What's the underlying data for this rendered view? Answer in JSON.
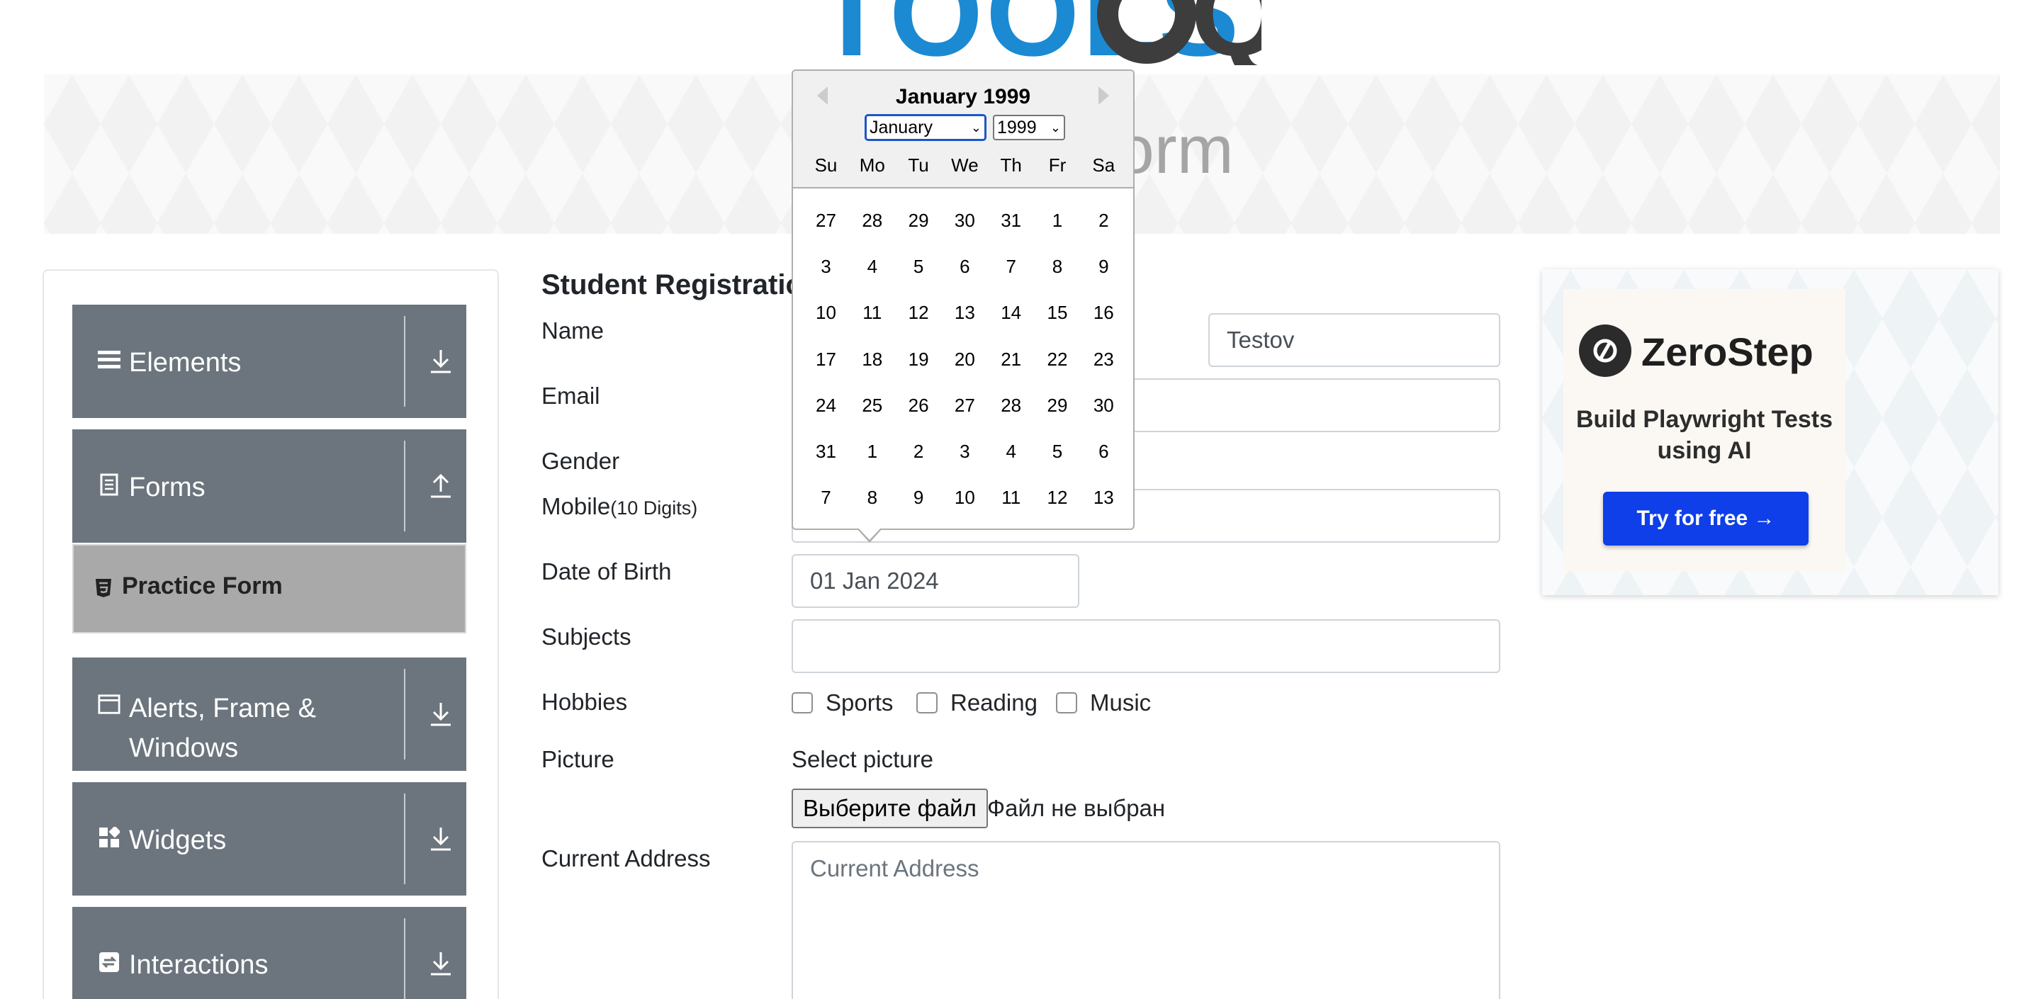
{
  "logo": {
    "text": "TOOLS",
    "text2": "QA"
  },
  "banner": {
    "title": "Practice Form"
  },
  "sidebar": {
    "groups": [
      {
        "label": "Elements",
        "icon": "hamburger-icon",
        "arrow": "download-arrow-icon"
      },
      {
        "label": "Forms",
        "icon": "document-icon",
        "arrow": "upload-arrow-icon"
      },
      {
        "label": "Alerts, Frame & Windows",
        "icon": "window-icon",
        "arrow": "download-arrow-icon"
      },
      {
        "label": "Widgets",
        "icon": "widgets-icon",
        "arrow": "download-arrow-icon"
      },
      {
        "label": "Interactions",
        "icon": "interactions-icon",
        "arrow": "download-arrow-icon"
      }
    ],
    "active_item": {
      "label": "Practice Form",
      "icon": "html5-icon"
    }
  },
  "form": {
    "title": "Student Registration Form",
    "labels": {
      "name": "Name",
      "email": "Email",
      "gender": "Gender",
      "mobile": "Mobile",
      "mobile_hint": "(10 Digits)",
      "dob": "Date of Birth",
      "subjects": "Subjects",
      "hobbies": "Hobbies",
      "picture": "Picture",
      "address": "Current Address"
    },
    "last_name_value": "Testov",
    "dob_value": "01 Jan 2024",
    "hobbies": [
      "Sports",
      "Reading",
      "Music"
    ],
    "picture_hint": "Select picture",
    "file_button": "Выберите файл",
    "file_status": "Файл не выбран",
    "address_placeholder": "Current Address"
  },
  "datepicker": {
    "current_month": "January 1999",
    "month_select": "January",
    "year_select": "1999",
    "weekdays": [
      "Su",
      "Mo",
      "Tu",
      "We",
      "Th",
      "Fr",
      "Sa"
    ],
    "weeks": [
      [
        "27",
        "28",
        "29",
        "30",
        "31",
        "1",
        "2"
      ],
      [
        "3",
        "4",
        "5",
        "6",
        "7",
        "8",
        "9"
      ],
      [
        "10",
        "11",
        "12",
        "13",
        "14",
        "15",
        "16"
      ],
      [
        "17",
        "18",
        "19",
        "20",
        "21",
        "22",
        "23"
      ],
      [
        "24",
        "25",
        "26",
        "27",
        "28",
        "29",
        "30"
      ],
      [
        "31",
        "1",
        "2",
        "3",
        "4",
        "5",
        "6"
      ],
      [
        "7",
        "8",
        "9",
        "10",
        "11",
        "12",
        "13"
      ]
    ]
  },
  "ad": {
    "brand": "ZeroStep",
    "tagline": "Build Playwright Tests using AI",
    "cta": "Try for free →"
  },
  "colors": {
    "sidebar_group": "#6c757d",
    "active_item": "#a9a9a9",
    "cta": "#0f3fe8",
    "logo_blue": "#1b8ad3"
  }
}
